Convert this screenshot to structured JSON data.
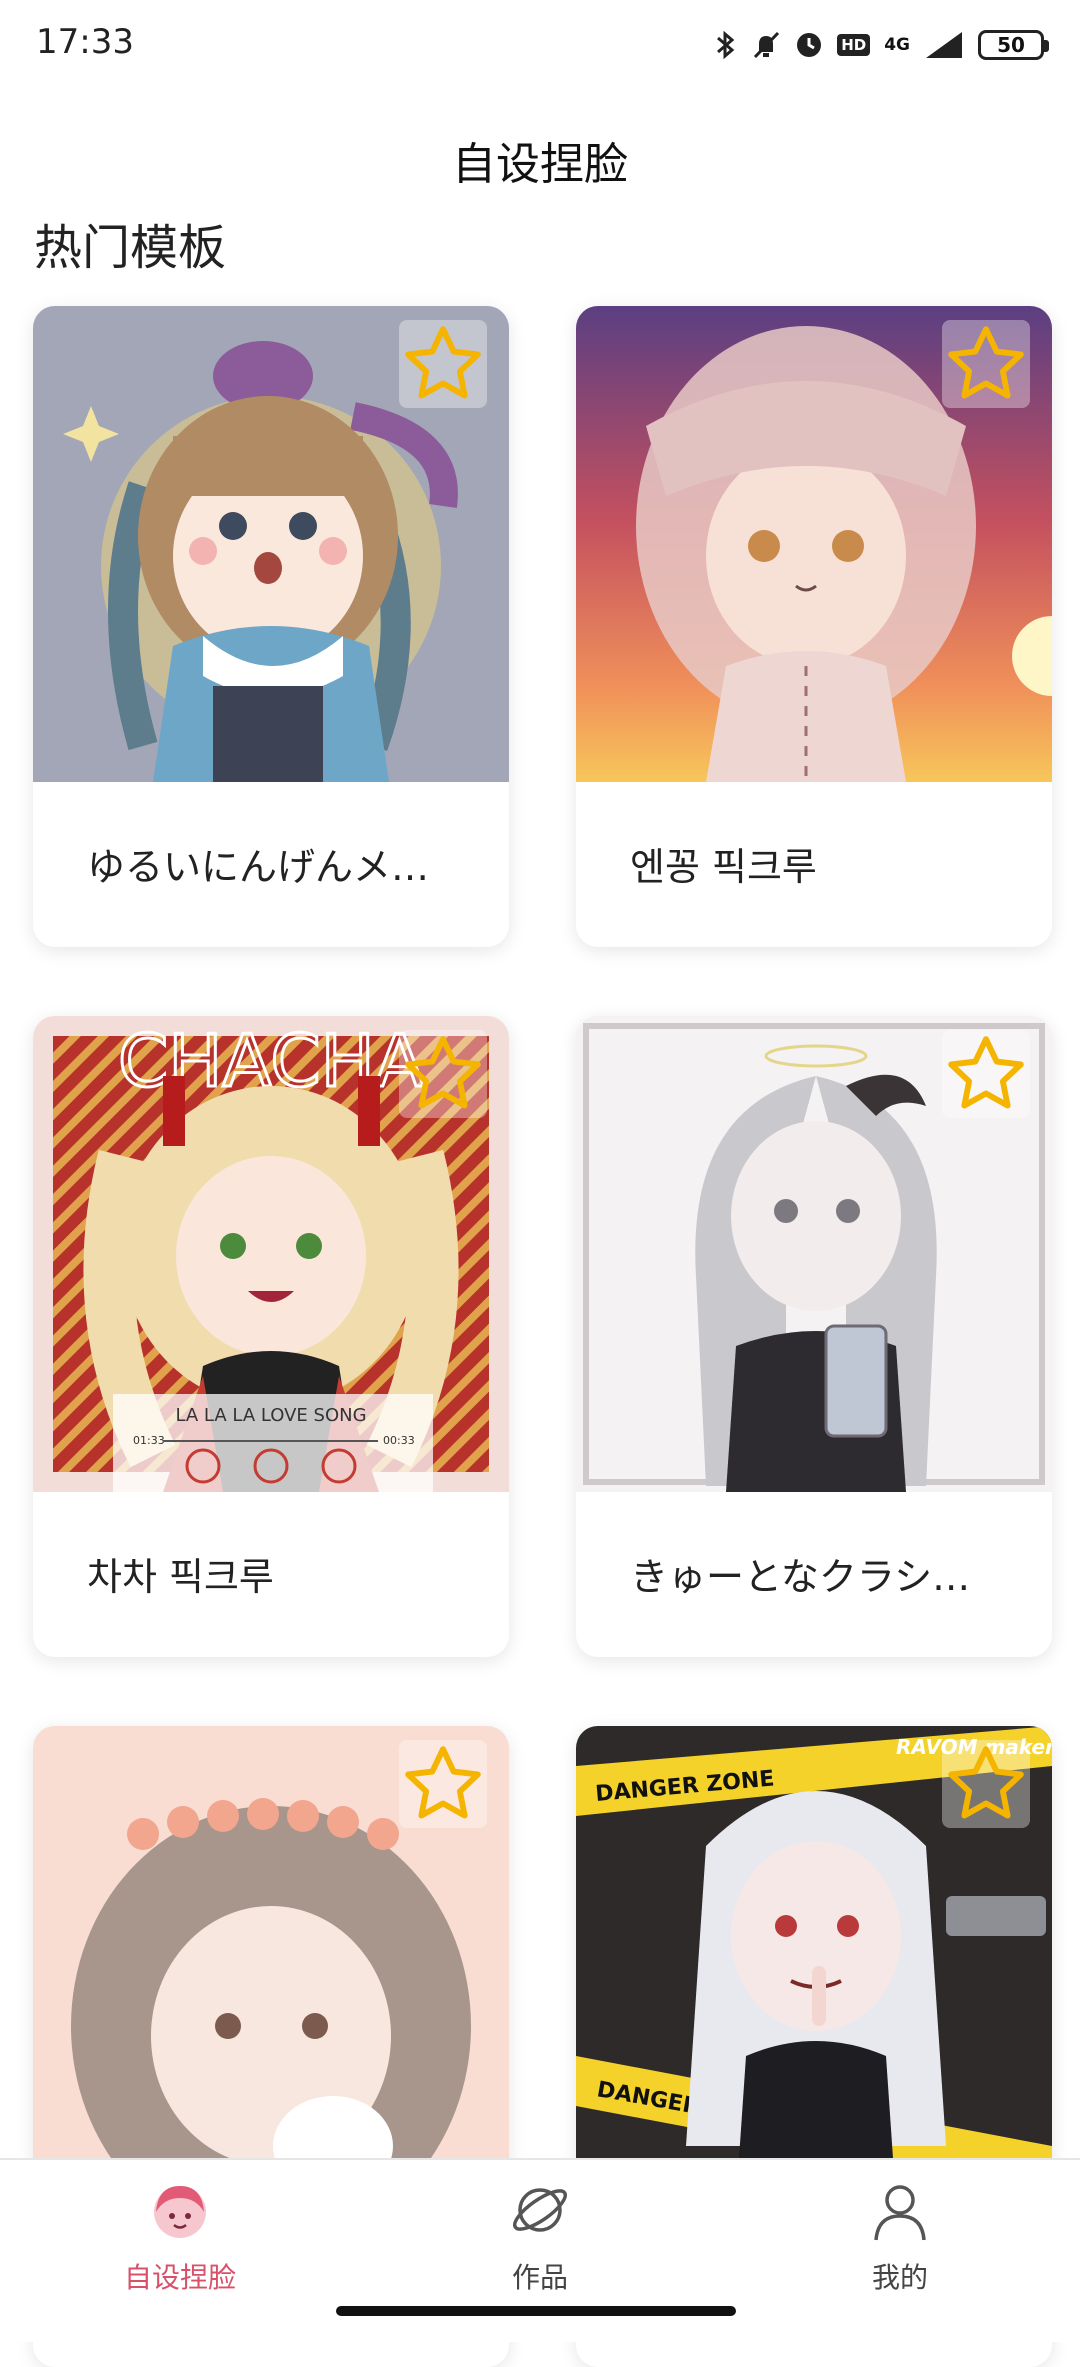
{
  "status_bar": {
    "time": "17:33",
    "network": "4G",
    "hd": "HD",
    "battery": "50",
    "icons": [
      "bluetooth-icon",
      "mute-icon",
      "alarm-icon",
      "hd-icon",
      "signal-icon",
      "battery-icon"
    ]
  },
  "header": {
    "title": "自设捏脸"
  },
  "section": {
    "title": "热门模板"
  },
  "templates": [
    {
      "label": "ゆるいにんげんメ…",
      "favorited": false
    },
    {
      "label": "엔꽁 픽크루",
      "favorited": false
    },
    {
      "label": "차차 픽크루",
      "favorited": false
    },
    {
      "label": "きゅーとなクラシ…",
      "favorited": false
    },
    {
      "label": "",
      "favorited": false
    },
    {
      "label": "",
      "favorited": false
    }
  ],
  "artwork_text": {
    "card3_banner": "CHACHA",
    "card3_song": "LA LA LA LOVE SONG",
    "card3_time_start": "01:33",
    "card3_time_end": "00:33",
    "card6_tape": "DANGER ZONE",
    "card6_tape2": "DANGER ZONE",
    "card6_watermark": "RAVOM maker"
  },
  "bottom_nav": {
    "items": [
      {
        "label": "自设捏脸",
        "icon": "face-avatar-icon",
        "active": true
      },
      {
        "label": "作品",
        "icon": "planet-icon",
        "active": false
      },
      {
        "label": "我的",
        "icon": "person-icon",
        "active": false
      }
    ]
  },
  "colors": {
    "accent": "#d9506a",
    "star": "#f5b400",
    "text": "#222222"
  }
}
